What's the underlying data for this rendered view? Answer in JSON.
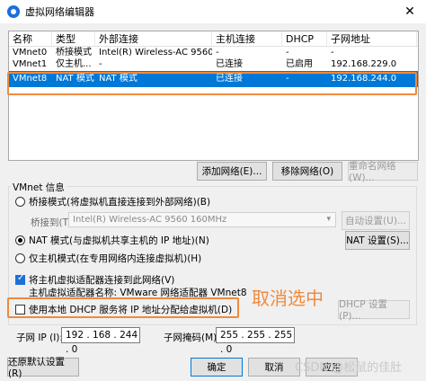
{
  "window": {
    "title": "虚拟网络编辑器",
    "close_glyph": "✕"
  },
  "table": {
    "headers": [
      "名称",
      "类型",
      "外部连接",
      "主机连接",
      "DHCP",
      "子网地址"
    ],
    "rows": [
      {
        "name": "VMnet0",
        "type": "桥接模式",
        "external": "Intel(R) Wireless-AC 9560 1...",
        "host": "-",
        "dhcp": "-",
        "subnet": "-"
      },
      {
        "name": "VMnet1",
        "type": "仅主机...",
        "external": "-",
        "host": "已连接",
        "dhcp": "已启用",
        "subnet": "192.168.229.0"
      },
      {
        "name": "VMnet8",
        "type": "NAT 模式",
        "external": "NAT 模式",
        "host": "已连接",
        "dhcp": "-",
        "subnet": "192.168.244.0"
      }
    ],
    "selected_index": 2
  },
  "network_buttons": {
    "add": "添加网络(E)...",
    "remove": "移除网络(O)",
    "rename": "重命名网络(W)..."
  },
  "vmnet_info": {
    "group_label": "VMnet 信息",
    "bridged_label": "桥接模式(将虚拟机直接连接到外部网络)(B)",
    "bridged_to_label": "桥接到(T):",
    "bridged_to_value": "Intel(R) Wireless-AC 9560 160MHz",
    "auto_settings": "自动设置(U)...",
    "nat_label": "NAT 模式(与虚拟机共享主机的 IP 地址)(N)",
    "nat_settings": "NAT 设置(S)...",
    "hostonly_label": "仅主机模式(在专用网络内连接虚拟机)(H)",
    "connect_adapter_label": "将主机虚拟适配器连接到此网络(V)",
    "adapter_name_label": "主机虚拟适配器名称: VMware 网络适配器 VMnet8",
    "dhcp_label": "使用本地 DHCP 服务将 IP 地址分配给虚拟机(D)",
    "dhcp_settings": "DHCP 设置(P)...",
    "subnet_ip_label": "子网 IP (I):",
    "subnet_ip": "192 . 168 . 244 . 0",
    "subnet_mask_label": "子网掩码(M):",
    "subnet_mask": "255 . 255 . 255 . 0",
    "mode": "nat",
    "connect_adapter_checked": true,
    "dhcp_checked": false
  },
  "footer": {
    "restore": "还原默认设置(R)",
    "ok": "确定",
    "cancel": "取消",
    "apply": "应用"
  },
  "annotation": {
    "note": "取消选中",
    "color": "#ef8a3c"
  },
  "watermark": "CSDN @松鼠的佳肚"
}
